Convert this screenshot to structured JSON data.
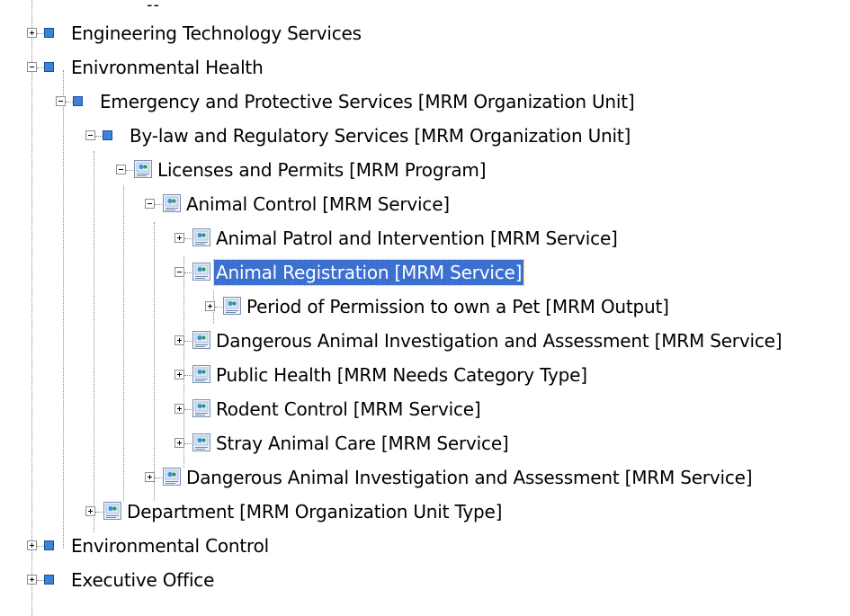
{
  "window": {
    "top_fragment": "--"
  },
  "tree": {
    "nodes": [
      {
        "label": "Engineering Technology Services",
        "level": 0,
        "state": "collapsed",
        "icon": "blue-square-icon"
      },
      {
        "label": "Enivronmental Health",
        "level": 0,
        "state": "expanded",
        "icon": "blue-square-icon"
      },
      {
        "label": "Emergency and Protective Services  [MRM Organization Unit]",
        "level": 1,
        "state": "expanded",
        "icon": "blue-square-icon"
      },
      {
        "label": "By-law and Regulatory Services  [MRM Organization Unit]",
        "level": 2,
        "state": "expanded",
        "icon": "blue-square-icon"
      },
      {
        "label": "Licenses and Permits  [MRM Program]",
        "level": 3,
        "state": "expanded",
        "icon": "document-icon"
      },
      {
        "label": "Animal Control  [MRM Service]",
        "level": 4,
        "state": "expanded",
        "icon": "document-icon"
      },
      {
        "label": "Animal Patrol and Intervention  [MRM Service]",
        "level": 5,
        "state": "collapsed",
        "icon": "document-icon"
      },
      {
        "label": "Animal Registration  [MRM Service]",
        "level": 5,
        "state": "expanded",
        "icon": "document-icon",
        "selected": true
      },
      {
        "label": "Period of Permission to own a Pet  [MRM Output]",
        "level": 6,
        "state": "collapsed",
        "icon": "document-icon"
      },
      {
        "label": "Dangerous Animal Investigation and Assessment  [MRM Service]",
        "level": 5,
        "state": "collapsed",
        "icon": "document-icon"
      },
      {
        "label": "Public Health  [MRM Needs Category Type]",
        "level": 5,
        "state": "collapsed",
        "icon": "document-icon"
      },
      {
        "label": "Rodent Control  [MRM Service]",
        "level": 5,
        "state": "collapsed",
        "icon": "document-icon"
      },
      {
        "label": "Stray Animal Care  [MRM Service]",
        "level": 5,
        "state": "collapsed",
        "icon": "document-icon"
      },
      {
        "label": "Dangerous Animal Investigation and Assessment  [MRM Service]",
        "level": 4,
        "state": "collapsed",
        "icon": "document-icon"
      },
      {
        "label": "Department  [MRM Organization Unit Type]",
        "level": 2,
        "state": "collapsed",
        "icon": "document-icon"
      },
      {
        "label": "Environmental Control",
        "level": 0,
        "state": "collapsed",
        "icon": "blue-square-icon"
      },
      {
        "label": "Executive Office",
        "level": 0,
        "state": "collapsed",
        "icon": "blue-square-icon"
      }
    ]
  },
  "colors": {
    "selection_background": "#3b6fd0",
    "selection_text": "#ffffff",
    "blue_square": "#3d82d9",
    "tree_lines": "#8a8a8a"
  }
}
